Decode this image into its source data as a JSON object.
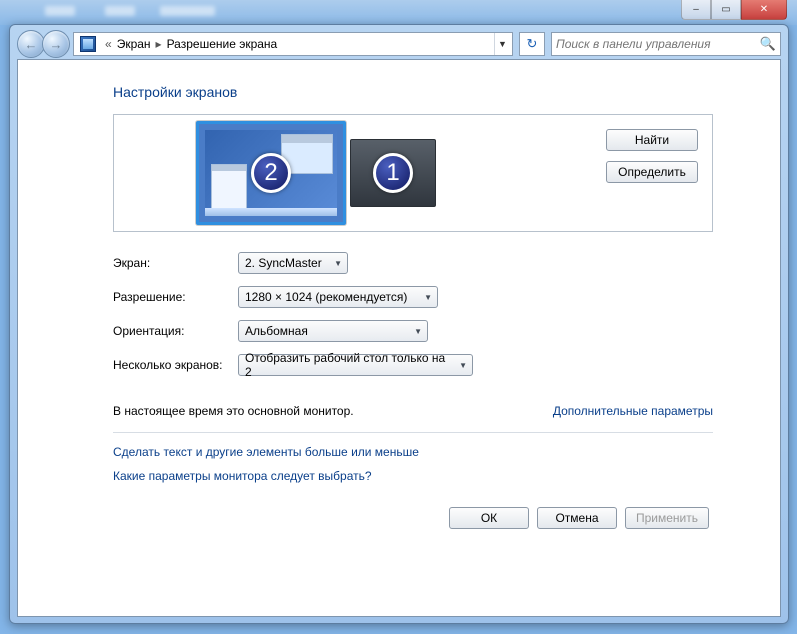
{
  "titlebar": {
    "min": "–",
    "max": "▭",
    "close": "✕"
  },
  "nav": {
    "back": "←",
    "forward": "→"
  },
  "breadcrumb": {
    "prefix": "«",
    "item1": "Экран",
    "item2": "Разрешение экрана"
  },
  "refresh": "↻",
  "search": {
    "placeholder": "Поиск в панели управления"
  },
  "page_title": "Настройки экранов",
  "monitors": {
    "num1": "1",
    "num2": "2",
    "find": "Найти",
    "identify": "Определить"
  },
  "form": {
    "display_label": "Экран:",
    "display_value": "2. SyncMaster",
    "resolution_label": "Разрешение:",
    "resolution_value": "1280 × 1024 (рекомендуется)",
    "orientation_label": "Ориентация:",
    "orientation_value": "Альбомная",
    "multi_label": "Несколько экранов:",
    "multi_value": "Отобразить рабочий стол только на 2"
  },
  "status": "В настоящее время это основной монитор.",
  "advanced_link": "Дополнительные параметры",
  "link_text_size": "Сделать текст и другие элементы больше или меньше",
  "link_which_settings": "Какие параметры монитора следует выбрать?",
  "buttons": {
    "ok": "ОК",
    "cancel": "Отмена",
    "apply": "Применить"
  }
}
